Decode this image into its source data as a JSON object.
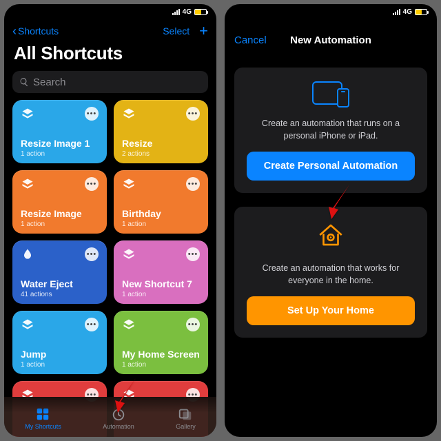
{
  "status": {
    "network": "4G"
  },
  "left": {
    "back_label": "Shortcuts",
    "select_label": "Select",
    "title": "All Shortcuts",
    "search_placeholder": "Search",
    "tiles": [
      {
        "name": "Resize Image 1",
        "sub": "1 action",
        "color": "#2aa7e8"
      },
      {
        "name": "Resize",
        "sub": "2 actions",
        "color": "#e3b315"
      },
      {
        "name": "Resize Image",
        "sub": "1 action",
        "color": "#f17a2d"
      },
      {
        "name": "Birthday",
        "sub": "1 action",
        "color": "#f17a2d"
      },
      {
        "name": "Water Eject",
        "sub": "41 actions",
        "color": "#2b61c9",
        "icon": "drop"
      },
      {
        "name": "New Shortcut 7",
        "sub": "1 action",
        "color": "#d96fbf"
      },
      {
        "name": "Jump",
        "sub": "1 action",
        "color": "#2aa7e8"
      },
      {
        "name": "My Home Screen",
        "sub": "1 action",
        "color": "#7bbf3f"
      },
      {
        "name": "",
        "sub": "",
        "color": "#e03d3d"
      },
      {
        "name": "",
        "sub": "",
        "color": "#e03d3d"
      }
    ],
    "tabs": {
      "my_shortcuts": "My Shortcuts",
      "automation": "Automation",
      "gallery": "Gallery"
    }
  },
  "right": {
    "cancel": "Cancel",
    "title": "New Automation",
    "personal_desc": "Create an automation that runs on a personal iPhone or iPad.",
    "personal_cta": "Create Personal Automation",
    "home_desc": "Create an automation that works for everyone in the home.",
    "home_cta": "Set Up Your Home"
  }
}
